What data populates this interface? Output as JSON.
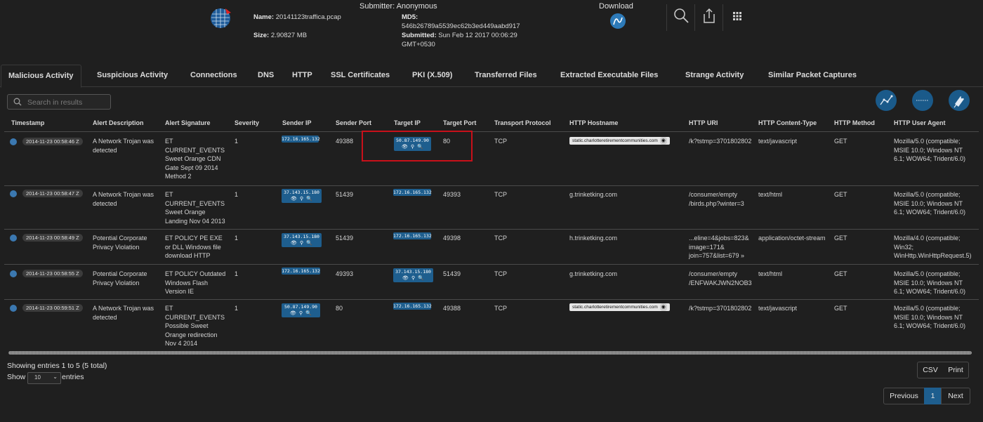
{
  "header": {
    "name_label": "Name:",
    "name_value": "20141123traffica.pcap",
    "size_label": "Size:",
    "size_value": "2.90827 MB",
    "submitter": "Submitter: Anonymous",
    "md5_label": "MD5:",
    "md5_value": "546b26789a5539ec62b3ed449aabd917",
    "submitted_label": "Submitted:",
    "submitted_value": "Sun Feb 12 2017 00:06:29",
    "submitted_tz": "GMT+0530",
    "download_label": "Download",
    "icons": [
      "logo-globe-icon",
      "download-wireshark-icon",
      "search-icon",
      "share-icon",
      "apps-grid-icon"
    ]
  },
  "tabs": [
    "Malicious Activity",
    "Suspicious Activity",
    "Connections",
    "DNS",
    "HTTP",
    "SSL Certificates",
    "PKI (X.509)",
    "Transferred Files",
    "Extracted Executable Files",
    "Strange Activity",
    "Similar Packet Captures"
  ],
  "search": {
    "placeholder": "Search in results"
  },
  "right_buttons": [
    "graph-icon",
    "timeline-icon",
    "tag-icon"
  ],
  "columns": [
    "Timestamp",
    "Alert Description",
    "Alert Signature",
    "Severity",
    "Sender IP",
    "Sender Port",
    "Target IP",
    "Target Port",
    "Transport Protocol",
    "HTTP Hostname",
    "HTTP URI",
    "HTTP Content-Type",
    "HTTP Method",
    "HTTP User Agent"
  ],
  "rows": [
    {
      "timestamp": "2014-11-23 00:58:46 Z",
      "description": "A Network Trojan was\ndetected",
      "signature": "ET\nCURRENT_EVENTS\nSweet Orange CDN\nGate Sept 09 2014\nMethod 2",
      "severity": "1",
      "sender_ip": "172.16.165.132",
      "sender_port": "49388",
      "target_ip": "50.87.149.90",
      "target_port": "80",
      "protocol": "TCP",
      "hostname": "static.charlotteretirementcommunities.com",
      "uri": "/k?tstmp=3701802802",
      "content_type": "text/javascript",
      "method": "GET",
      "user_agent": "Mozilla/5.0 (compatible;\nMSIE 10.0; Windows NT\n6.1; WOW64; Trident/6.0)"
    },
    {
      "timestamp": "2014-11-23 00:58:47 Z",
      "description": "A Network Trojan was\ndetected",
      "signature": "ET\nCURRENT_EVENTS\nSweet Orange\nLanding Nov 04 2013",
      "severity": "1",
      "sender_ip": "37.143.15.180",
      "sender_port": "51439",
      "target_ip": "172.16.165.132",
      "target_port": "49393",
      "protocol": "TCP",
      "hostname": "g.trinketking.com",
      "uri": "/consumer/empty\n/birds.php?winter=3",
      "content_type": "text/html",
      "method": "GET",
      "user_agent": "Mozilla/5.0 (compatible;\nMSIE 10.0; Windows NT\n6.1; WOW64; Trident/6.0)"
    },
    {
      "timestamp": "2014-11-23 00:58:49 Z",
      "description": "Potential Corporate\nPrivacy Violation",
      "signature": "ET POLICY PE EXE\nor DLL Windows file\ndownload HTTP",
      "severity": "1",
      "sender_ip": "37.143.15.180",
      "sender_port": "51439",
      "target_ip": "172.16.165.132",
      "target_port": "49398",
      "protocol": "TCP",
      "hostname": "h.trinketking.com",
      "uri": "...eline=4&jobs=823&\nimage=171&\njoin=757&list=679 »",
      "content_type": "application/octet-stream",
      "method": "GET",
      "user_agent": "Mozilla/4.0 (compatible;\nWin32;\nWinHttp.WinHttpRequest.5)"
    },
    {
      "timestamp": "2014-11-23 00:58:55 Z",
      "description": "Potential Corporate\nPrivacy Violation",
      "signature": "ET POLICY Outdated\nWindows Flash\nVersion IE",
      "severity": "1",
      "sender_ip": "172.16.165.132",
      "sender_port": "49393",
      "target_ip": "37.143.15.180",
      "target_port": "51439",
      "protocol": "TCP",
      "hostname": "g.trinketking.com",
      "uri": "/consumer/empty\n/ENFWAKJWN2NOB3",
      "content_type": "text/html",
      "method": "GET",
      "user_agent": "Mozilla/5.0 (compatible;\nMSIE 10.0; Windows NT\n6.1; WOW64; Trident/6.0)"
    },
    {
      "timestamp": "2014-11-23 00:59:51 Z",
      "description": "A Network Trojan was\ndetected",
      "signature": "ET\nCURRENT_EVENTS\nPossible Sweet\nOrange redirection\nNov 4 2014",
      "severity": "1",
      "sender_ip": "50.87.149.90",
      "sender_port": "80",
      "target_ip": "172.16.165.132",
      "target_port": "49388",
      "protocol": "TCP",
      "hostname": "static.charlotteretirementcommunities.com",
      "uri": "/k?tstmp=3701802802",
      "content_type": "text/javascript",
      "method": "GET",
      "user_agent": "Mozilla/5.0 (compatible;\nMSIE 10.0; Windows NT\n6.1; WOW64; Trident/6.0)"
    }
  ],
  "footer": {
    "showing": "Showing entries 1 to 5 (5 total)",
    "show_label": "Show",
    "page_size": "10",
    "entries_label": "entries",
    "csv": "CSV",
    "print": "Print",
    "previous": "Previous",
    "page": "1",
    "next": "Next"
  },
  "colors": {
    "accent": "#1e5e8e",
    "highlight": "#c8101a",
    "background": "#1f1f1f"
  }
}
